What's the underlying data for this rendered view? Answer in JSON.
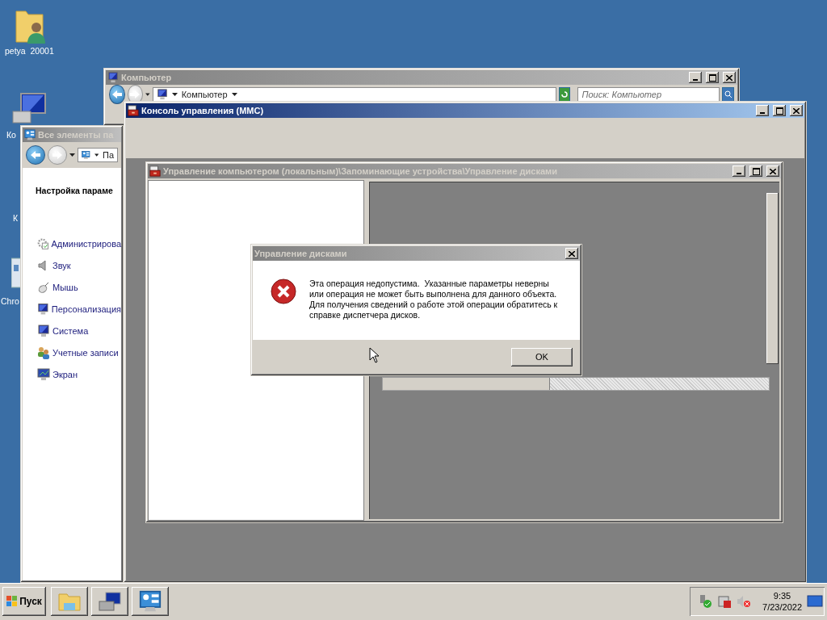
{
  "desktop": {
    "icons": [
      {
        "label": "petya  20001"
      },
      {
        "label": "Ко"
      },
      {
        "label": "К"
      },
      {
        "label": "Chro"
      }
    ]
  },
  "computer_window": {
    "title": "Компьютер",
    "active": false,
    "address": "Компьютер",
    "search": {
      "placeholder": "Поиск: Компьютер"
    }
  },
  "control_panel_window": {
    "title": "Все элементы па",
    "active": false,
    "address": "Па",
    "heading": "Настройка параме",
    "items": [
      {
        "label": "Администрирова"
      },
      {
        "label": "Звук"
      },
      {
        "label": "Мышь"
      },
      {
        "label": "Персонализация"
      },
      {
        "label": "Система"
      },
      {
        "label": "Учетные записи"
      },
      {
        "label": "Экран"
      }
    ]
  },
  "mmc_window": {
    "title": "Консоль управления (MMC)",
    "active": true,
    "child_window": {
      "title": "Управление компьютером (локальным)\\Запоминающие устройства\\Управление дисками",
      "active": false
    }
  },
  "dialog": {
    "title": "Управление дисками",
    "active": false,
    "message": "Эта операция недопустима.  Указанные параметры неверны или операция не может быть выполнена для данного объекта.  Для получения сведений о работе этой операции обратитесь к справке диспетчера дисков.",
    "buttons": [
      "OK"
    ]
  },
  "taskbar": {
    "start": "Пуск",
    "time": "9:35",
    "date": "7/23/2022"
  }
}
